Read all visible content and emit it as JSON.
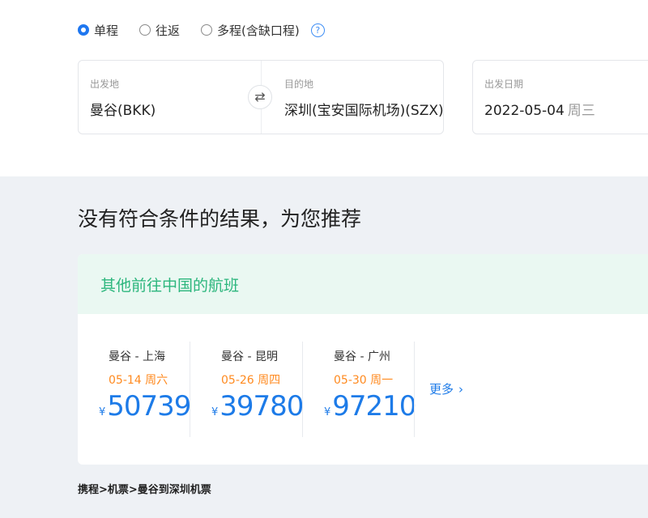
{
  "trip_types": [
    {
      "label": "单程",
      "selected": true
    },
    {
      "label": "往返",
      "selected": false
    },
    {
      "label": "多程(含缺口程)",
      "selected": false
    }
  ],
  "help_icon_glyph": "?",
  "search": {
    "departure_label": "出发地",
    "departure_value": "曼谷(BKK)",
    "swap_glyph": "⇄",
    "arrival_label": "目的地",
    "arrival_value": "深圳(宝安国际机场)(SZX)",
    "date_label": "出发日期",
    "date_value": "2022-05-04",
    "date_weekday": "周三"
  },
  "main": {
    "no_result_text": "没有符合条件的结果，为您推荐",
    "recommend_title": "其他前往中国的航班",
    "flights": [
      {
        "route": "曼谷 - 上海",
        "date": "05-14 周六",
        "currency": "¥",
        "price": "50739"
      },
      {
        "route": "曼谷 - 昆明",
        "date": "05-26 周四",
        "currency": "¥",
        "price": "39780"
      },
      {
        "route": "曼谷 - 广州",
        "date": "05-30 周一",
        "currency": "¥",
        "price": "97210"
      }
    ],
    "more_label": "更多",
    "more_glyph": "›"
  },
  "breadcrumb": "携程>机票>曼谷到深圳机票",
  "colors": {
    "accent_blue": "#1f77f0",
    "price_blue": "#1d7be8",
    "date_orange": "#ff8a1f",
    "recommend_green": "#2cb67d",
    "recommend_bg": "#eaf8f2",
    "page_bg": "#eef1f5"
  }
}
